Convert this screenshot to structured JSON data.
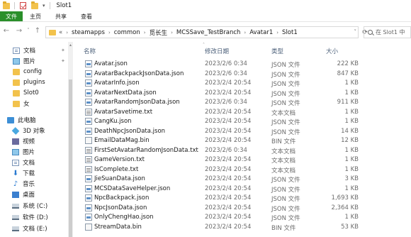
{
  "window": {
    "title": "Slot1"
  },
  "ribbon": {
    "tabs": [
      "文件",
      "主页",
      "共享",
      "查看"
    ]
  },
  "address": {
    "overflow": "«",
    "crumbs": [
      "steamapps",
      "common",
      "觅长生",
      "MCSSave_TestBranch",
      "Avatar1",
      "Slot1"
    ]
  },
  "search": {
    "placeholder": "在 Slot1 中"
  },
  "nav": {
    "quick": [
      "文档",
      "图片",
      "config",
      "plugins",
      "Slot0",
      "女"
    ],
    "pc_label": "此电脑",
    "pc_items": [
      "3D 对象",
      "视频",
      "图片",
      "文档",
      "下载",
      "音乐",
      "桌面",
      "系统 (C:)",
      "软件 (D:)",
      "文档 (E:)"
    ]
  },
  "columns": {
    "name": "名称",
    "date": "修改日期",
    "type": "类型",
    "size": "大小"
  },
  "files": [
    {
      "name": "Avatar.json",
      "date": "2023/2/6 0:34",
      "type": "JSON 文件",
      "size": "222 KB",
      "kind": "json"
    },
    {
      "name": "AvatarBackpackJsonData.json",
      "date": "2023/2/6 0:34",
      "type": "JSON 文件",
      "size": "847 KB",
      "kind": "json"
    },
    {
      "name": "AvatarInfo.json",
      "date": "2023/2/4 20:54",
      "type": "JSON 文件",
      "size": "1 KB",
      "kind": "json"
    },
    {
      "name": "AvatarNextData.json",
      "date": "2023/2/4 20:54",
      "type": "JSON 文件",
      "size": "1 KB",
      "kind": "json"
    },
    {
      "name": "AvatarRandomJsonData.json",
      "date": "2023/2/6 0:34",
      "type": "JSON 文件",
      "size": "911 KB",
      "kind": "json"
    },
    {
      "name": "AvatarSavetime.txt",
      "date": "2023/2/4 20:54",
      "type": "文本文档",
      "size": "1 KB",
      "kind": "txt"
    },
    {
      "name": "CangKu.json",
      "date": "2023/2/4 20:54",
      "type": "JSON 文件",
      "size": "1 KB",
      "kind": "json"
    },
    {
      "name": "DeathNpcJsonData.json",
      "date": "2023/2/4 20:54",
      "type": "JSON 文件",
      "size": "14 KB",
      "kind": "json"
    },
    {
      "name": "EmailDataMag.bin",
      "date": "2023/2/4 20:54",
      "type": "BIN 文件",
      "size": "12 KB",
      "kind": "bin"
    },
    {
      "name": "FirstSetAvatarRandomJsonData.txt",
      "date": "2023/2/6 0:34",
      "type": "文本文档",
      "size": "1 KB",
      "kind": "txt"
    },
    {
      "name": "GameVersion.txt",
      "date": "2023/2/4 20:54",
      "type": "文本文档",
      "size": "1 KB",
      "kind": "txt"
    },
    {
      "name": "IsComplete.txt",
      "date": "2023/2/4 20:54",
      "type": "文本文档",
      "size": "1 KB",
      "kind": "txt"
    },
    {
      "name": "JieSuanData.json",
      "date": "2023/2/4 20:54",
      "type": "JSON 文件",
      "size": "3 KB",
      "kind": "json"
    },
    {
      "name": "MCSDataSaveHelper.json",
      "date": "2023/2/4 20:54",
      "type": "JSON 文件",
      "size": "1 KB",
      "kind": "json"
    },
    {
      "name": "NpcBackpack.json",
      "date": "2023/2/4 20:54",
      "type": "JSON 文件",
      "size": "1,693 KB",
      "kind": "json"
    },
    {
      "name": "NpcJsonData.json",
      "date": "2023/2/4 20:54",
      "type": "JSON 文件",
      "size": "2,364 KB",
      "kind": "json"
    },
    {
      "name": "OnlyChengHao.json",
      "date": "2023/2/4 20:54",
      "type": "JSON 文件",
      "size": "1 KB",
      "kind": "json"
    },
    {
      "name": "StreamData.bin",
      "date": "2023/2/4 20:54",
      "type": "BIN 文件",
      "size": "53 KB",
      "kind": "bin"
    }
  ]
}
